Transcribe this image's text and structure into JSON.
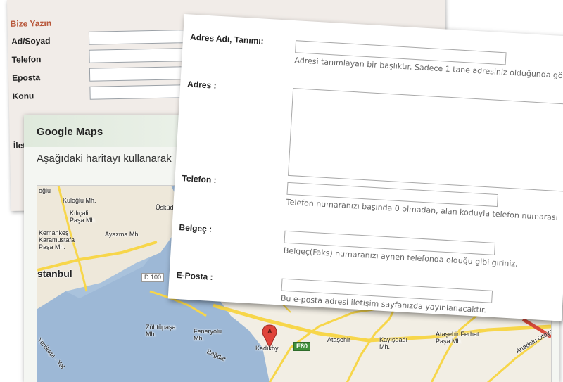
{
  "contact_form": {
    "title": "Bize Yazın",
    "labels": [
      "Ad/Soyad",
      "Telefon",
      "Eposta",
      "Konu"
    ],
    "partial_label": "İlet"
  },
  "google_maps": {
    "title": "Google Maps",
    "intro": "Aşağıdaki haritayı kullanarak",
    "marker_letter": "A",
    "places": {
      "ogl": "oğlu",
      "kuloglu": "Kuloğlu Mh.",
      "kilicali": "Kılıçali\nPaşa Mh.",
      "uskudar": "Üsküdar",
      "kemankes": "Kemankeş\nKaramustafa\nPaşa Mh.",
      "ayazma": "Ayazma Mh.",
      "istanbul": "İstanbul",
      "zuhtupasa": "Zühtüpaşa\nMh.",
      "feneryolu": "Feneryolu\nMh.",
      "kadikoy": "Kadıköy",
      "atasehir": "Ataşehir",
      "kayisdagi": "Kayışdağı\nMh.",
      "atasehir_ferhat": "Ataşehir Ferhat\nPaşa Mh.",
      "anadolu": "Anadolu Otoyolu",
      "yenikapi": "Yenikapı - Yal",
      "bagdat": "Bağdat"
    },
    "road_shields": {
      "d100": "D 100",
      "e80": "E80"
    }
  },
  "address_form": {
    "fields": [
      {
        "label": "Adres Adı, Tanımı:",
        "hint": "Adresi tanımlayan bir başlıktır. Sadece 1 tane adresiniz olduğunda göster"
      },
      {
        "label": "Adres :"
      },
      {
        "label": "Telefon :",
        "hint": "Telefon numaranızı başında 0 olmadan, alan koduyla telefon numarası"
      },
      {
        "label": "Belgeç :",
        "hint": "Belgeç(Faks) numaranızı aynen telefonda olduğu gibi giriniz."
      },
      {
        "label": "E-Posta :",
        "hint": "Bu e-posta adresi iletişim sayfanızda yayınlanacaktır."
      }
    ]
  },
  "colors": {
    "contact_title": "#b8573a",
    "map_water": "#9db8d6",
    "map_land": "#f2eee4",
    "map_road_yellow": "#f7d64a",
    "map_shield_green": "#3f8f3a",
    "marker_red": "#e0443a"
  }
}
